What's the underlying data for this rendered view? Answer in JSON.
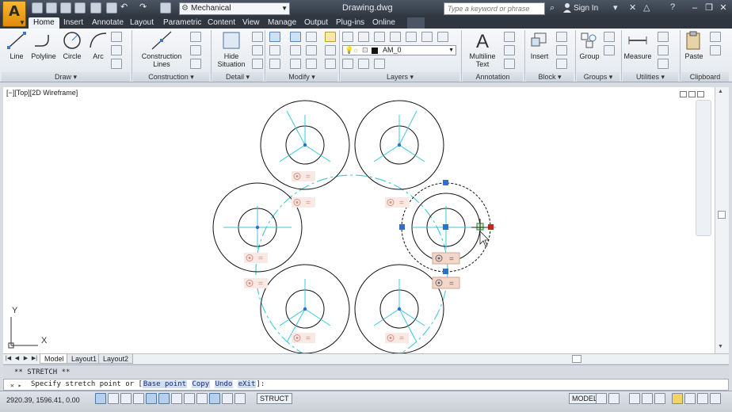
{
  "titlebar": {
    "logo_letter": "A",
    "workspace": "Mechanical",
    "document": "Drawing.dwg",
    "search_placeholder": "Type a keyword or phrase",
    "sign_in": "Sign In"
  },
  "tabs": [
    "Home",
    "Insert",
    "Annotate",
    "Layout",
    "Parametric",
    "Content",
    "View",
    "Manage",
    "Output",
    "Plug-ins",
    "Online"
  ],
  "ribbon": {
    "draw": {
      "title": "Draw",
      "line": "Line",
      "polyline": "Polyline",
      "circle": "Circle",
      "arc": "Arc"
    },
    "construction": {
      "title": "Construction",
      "lines_1": "Construction",
      "lines_2": "Lines"
    },
    "detail": {
      "title": "Detail",
      "hide_1": "Hide",
      "hide_2": "Situation"
    },
    "modify": {
      "title": "Modify"
    },
    "layers": {
      "title": "Layers",
      "current_layer": "AM_0"
    },
    "annotation": {
      "title": "Annotation",
      "mtext_1": "Multiline",
      "mtext_2": "Text"
    },
    "block": {
      "title": "Block",
      "insert": "Insert"
    },
    "groups": {
      "title": "Groups",
      "group": "Group"
    },
    "utilities": {
      "title": "Utilities",
      "measure": "Measure"
    },
    "clipboard": {
      "title": "Clipboard",
      "paste": "Paste"
    }
  },
  "viewport": {
    "label": "[−][Top][2D Wireframe]",
    "ucs_y": "Y",
    "ucs_x": "X"
  },
  "layout_tabs": [
    "Model",
    "Layout1",
    "Layout2"
  ],
  "command": {
    "history": "** STRETCH **",
    "prompt_prefix": "Specify stretch point or [",
    "options": [
      "Base point",
      "Copy",
      "Undo",
      "eXit"
    ],
    "prompt_suffix": "]:"
  },
  "status": {
    "coords": "2920.39, 1596.41, 0.00",
    "struct": "STRUCT",
    "model": "MODEL"
  },
  "colors": {
    "accent_cyan": "#3cc8d8",
    "grip_blue": "#2f6fd0",
    "grip_red": "#c8261f",
    "grip_green": "#3b9c3b"
  }
}
